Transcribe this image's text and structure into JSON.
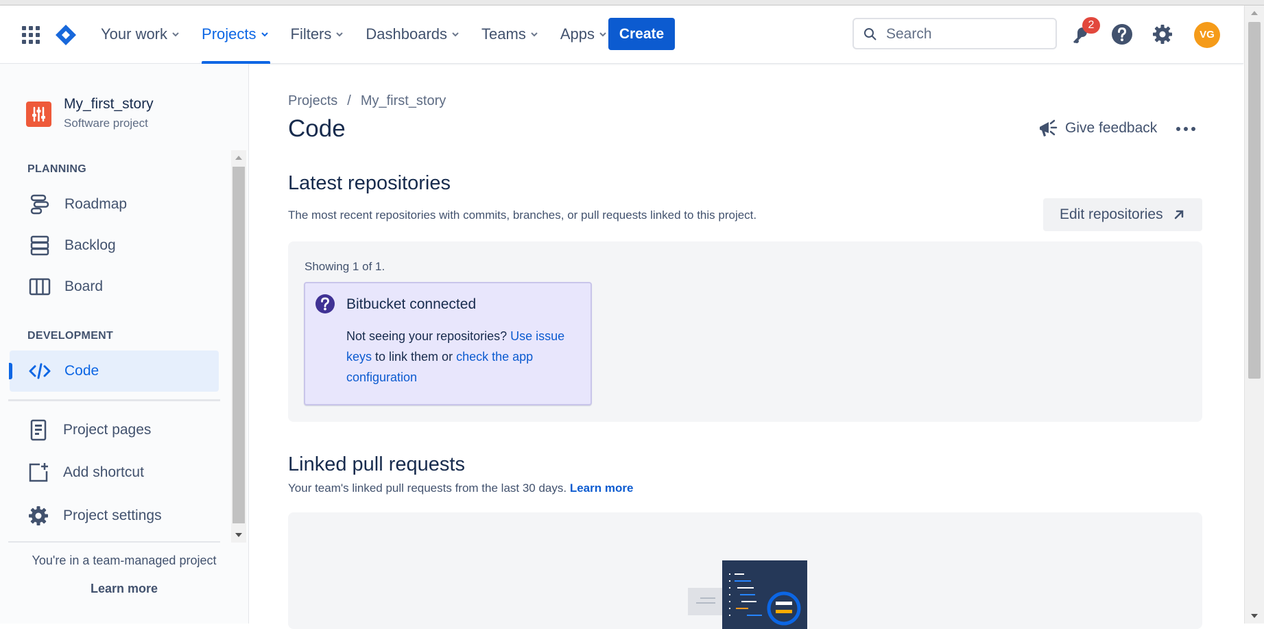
{
  "header": {
    "nav": [
      {
        "label": "Your work",
        "active": false
      },
      {
        "label": "Projects",
        "active": true
      },
      {
        "label": "Filters",
        "active": false
      },
      {
        "label": "Dashboards",
        "active": false
      },
      {
        "label": "Teams",
        "active": false
      },
      {
        "label": "Apps",
        "active": false
      }
    ],
    "create_label": "Create",
    "search_placeholder": "Search",
    "notification_count": "2",
    "avatar_initials": "VG",
    "accent_color": "#0c66e4",
    "avatar_color": "#f59b19"
  },
  "sidebar": {
    "project_name": "My_first_story",
    "project_type": "Software project",
    "planning_label": "PLANNING",
    "planning_items": [
      {
        "label": "Roadmap",
        "icon": "roadmap-icon"
      },
      {
        "label": "Backlog",
        "icon": "backlog-icon"
      },
      {
        "label": "Board",
        "icon": "board-icon"
      }
    ],
    "development_label": "DEVELOPMENT",
    "development_items": [
      {
        "label": "Code",
        "icon": "code-icon",
        "active": true
      }
    ],
    "links": [
      {
        "label": "Project pages",
        "icon": "project-pages-icon"
      },
      {
        "label": "Add shortcut",
        "icon": "add-shortcut-icon"
      },
      {
        "label": "Project settings",
        "icon": "settings-icon"
      }
    ],
    "team_note": "You're in a team-managed project",
    "learn_more": "Learn more"
  },
  "main": {
    "breadcrumb": [
      "Projects",
      "My_first_story"
    ],
    "title": "Code",
    "feedback_label": "Give feedback",
    "latest_repos": {
      "heading": "Latest repositories",
      "description": "The most recent repositories with commits, branches, or pull requests linked to this project.",
      "edit_label": "Edit repositories",
      "showing": "Showing 1 of 1.",
      "card": {
        "title": "Bitbucket connected",
        "text_1": "Not seeing your repositories? ",
        "link_1": "Use issue keys",
        "text_2": " to link them or ",
        "link_2": "check the app configuration"
      }
    },
    "linked_prs": {
      "heading": "Linked pull requests",
      "description": "Your team's linked pull requests from the last 30 days.",
      "learn_more": "Learn more"
    }
  }
}
